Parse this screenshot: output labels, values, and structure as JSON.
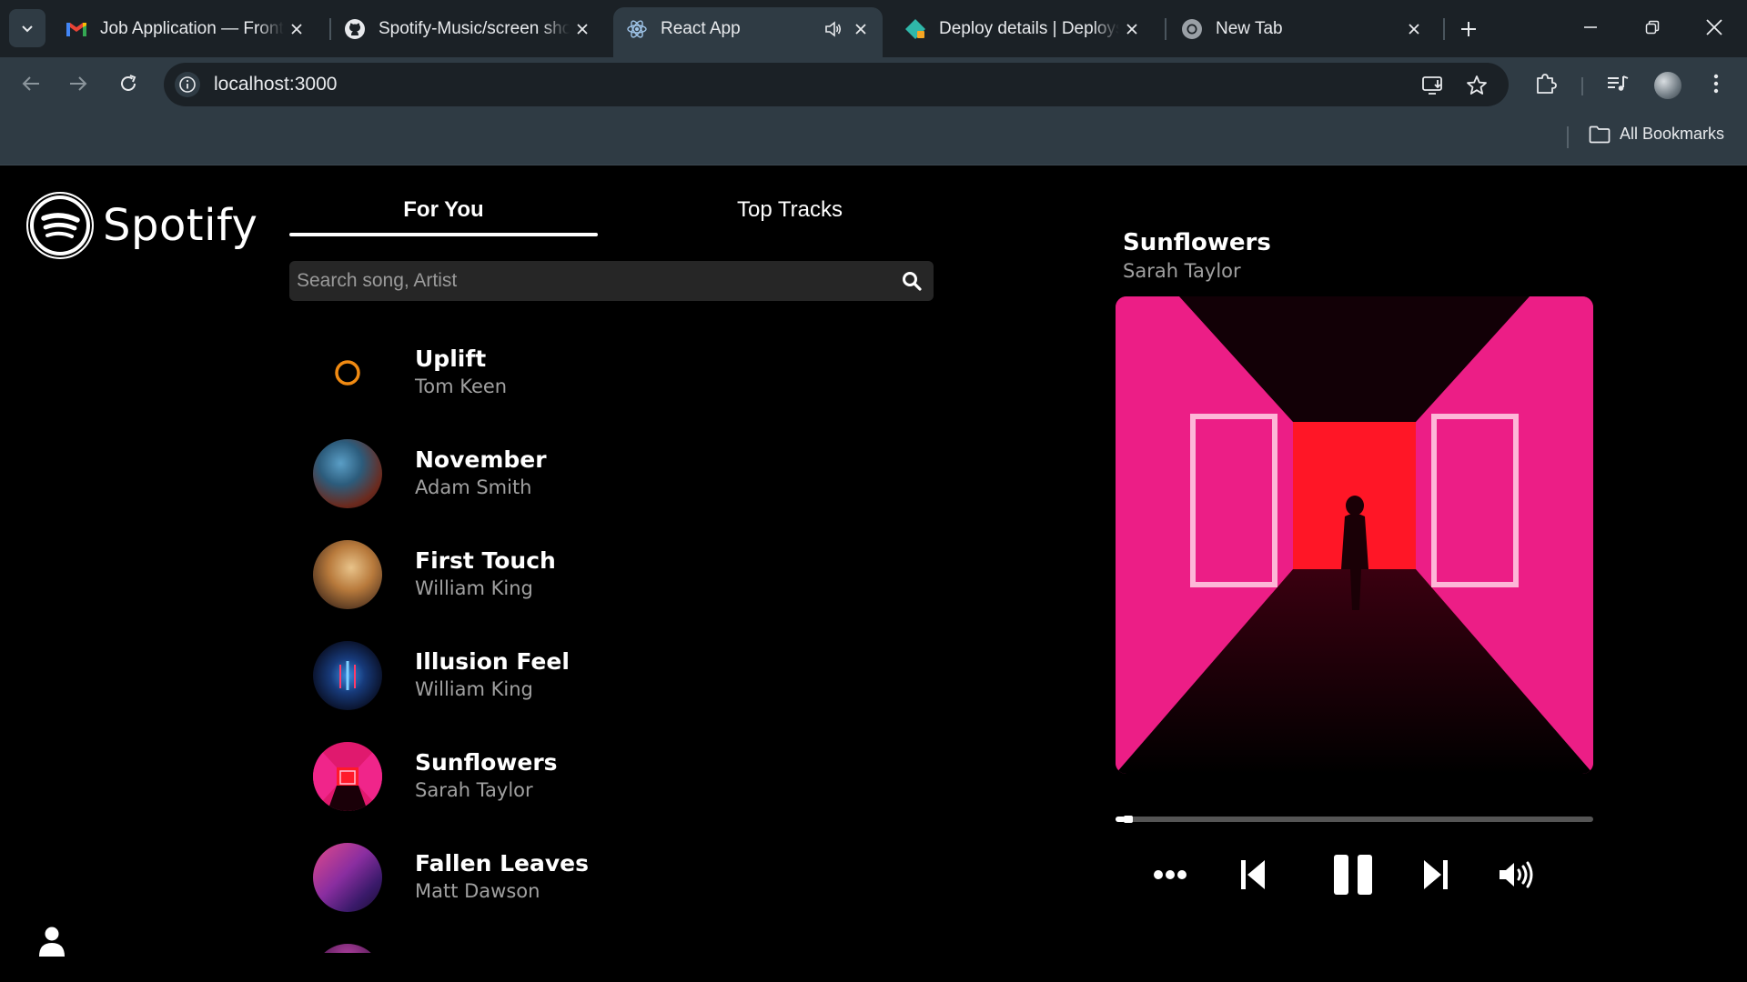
{
  "browser": {
    "tabs": [
      {
        "title": "Job Application — Frontend",
        "icon": "gmail-icon"
      },
      {
        "title": "Spotify-Music/screen shot",
        "icon": "github-icon"
      },
      {
        "title": "React App",
        "icon": "react-icon",
        "active": true,
        "audio": true
      },
      {
        "title": "Deploy details | Deploys | ",
        "icon": "netlify-icon"
      },
      {
        "title": "New Tab",
        "icon": "chrome-icon"
      }
    ],
    "url": "localhost:3000",
    "bookmarks_label": "All Bookmarks"
  },
  "app": {
    "brand": "Spotify",
    "tabs": [
      {
        "label": "For You",
        "active": true
      },
      {
        "label": "Top Tracks",
        "active": false
      }
    ],
    "search_placeholder": "Search song, Artist",
    "songs": [
      {
        "name": "Uplift",
        "artist": "Tom Keen"
      },
      {
        "name": "November",
        "artist": "Adam Smith"
      },
      {
        "name": "First Touch",
        "artist": "William King"
      },
      {
        "name": "Illusion Feel",
        "artist": "William King"
      },
      {
        "name": "Sunflowers",
        "artist": "Sarah Taylor"
      },
      {
        "name": "Fallen Leaves",
        "artist": "Matt Dawson"
      }
    ],
    "now_playing": {
      "title": "Sunflowers",
      "artist": "Sarah Taylor",
      "progress_fraction": 0.02,
      "state": "playing"
    }
  },
  "colors": {
    "accent_orange": "#f08a12",
    "cover_pink": "#e0196e",
    "cover_red": "#ff1a2a"
  }
}
